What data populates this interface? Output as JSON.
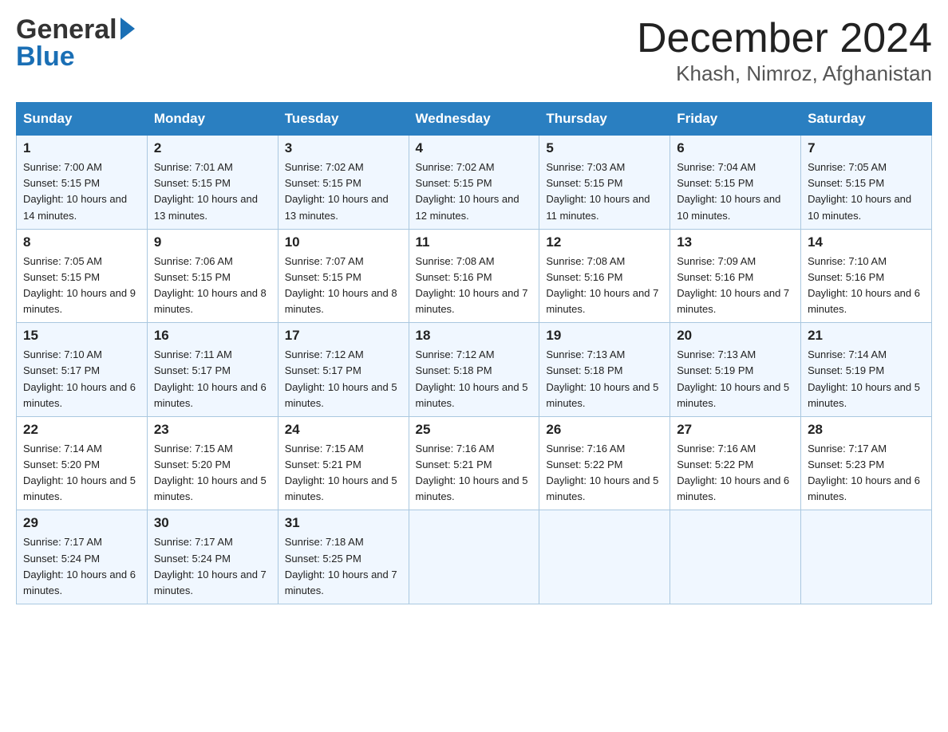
{
  "header": {
    "logo_general": "General",
    "logo_blue": "Blue",
    "month_title": "December 2024",
    "location": "Khash, Nimroz, Afghanistan"
  },
  "days_of_week": [
    "Sunday",
    "Monday",
    "Tuesday",
    "Wednesday",
    "Thursday",
    "Friday",
    "Saturday"
  ],
  "weeks": [
    [
      {
        "day": "1",
        "sunrise": "7:00 AM",
        "sunset": "5:15 PM",
        "daylight": "10 hours and 14 minutes."
      },
      {
        "day": "2",
        "sunrise": "7:01 AM",
        "sunset": "5:15 PM",
        "daylight": "10 hours and 13 minutes."
      },
      {
        "day": "3",
        "sunrise": "7:02 AM",
        "sunset": "5:15 PM",
        "daylight": "10 hours and 13 minutes."
      },
      {
        "day": "4",
        "sunrise": "7:02 AM",
        "sunset": "5:15 PM",
        "daylight": "10 hours and 12 minutes."
      },
      {
        "day": "5",
        "sunrise": "7:03 AM",
        "sunset": "5:15 PM",
        "daylight": "10 hours and 11 minutes."
      },
      {
        "day": "6",
        "sunrise": "7:04 AM",
        "sunset": "5:15 PM",
        "daylight": "10 hours and 10 minutes."
      },
      {
        "day": "7",
        "sunrise": "7:05 AM",
        "sunset": "5:15 PM",
        "daylight": "10 hours and 10 minutes."
      }
    ],
    [
      {
        "day": "8",
        "sunrise": "7:05 AM",
        "sunset": "5:15 PM",
        "daylight": "10 hours and 9 minutes."
      },
      {
        "day": "9",
        "sunrise": "7:06 AM",
        "sunset": "5:15 PM",
        "daylight": "10 hours and 8 minutes."
      },
      {
        "day": "10",
        "sunrise": "7:07 AM",
        "sunset": "5:15 PM",
        "daylight": "10 hours and 8 minutes."
      },
      {
        "day": "11",
        "sunrise": "7:08 AM",
        "sunset": "5:16 PM",
        "daylight": "10 hours and 7 minutes."
      },
      {
        "day": "12",
        "sunrise": "7:08 AM",
        "sunset": "5:16 PM",
        "daylight": "10 hours and 7 minutes."
      },
      {
        "day": "13",
        "sunrise": "7:09 AM",
        "sunset": "5:16 PM",
        "daylight": "10 hours and 7 minutes."
      },
      {
        "day": "14",
        "sunrise": "7:10 AM",
        "sunset": "5:16 PM",
        "daylight": "10 hours and 6 minutes."
      }
    ],
    [
      {
        "day": "15",
        "sunrise": "7:10 AM",
        "sunset": "5:17 PM",
        "daylight": "10 hours and 6 minutes."
      },
      {
        "day": "16",
        "sunrise": "7:11 AM",
        "sunset": "5:17 PM",
        "daylight": "10 hours and 6 minutes."
      },
      {
        "day": "17",
        "sunrise": "7:12 AM",
        "sunset": "5:17 PM",
        "daylight": "10 hours and 5 minutes."
      },
      {
        "day": "18",
        "sunrise": "7:12 AM",
        "sunset": "5:18 PM",
        "daylight": "10 hours and 5 minutes."
      },
      {
        "day": "19",
        "sunrise": "7:13 AM",
        "sunset": "5:18 PM",
        "daylight": "10 hours and 5 minutes."
      },
      {
        "day": "20",
        "sunrise": "7:13 AM",
        "sunset": "5:19 PM",
        "daylight": "10 hours and 5 minutes."
      },
      {
        "day": "21",
        "sunrise": "7:14 AM",
        "sunset": "5:19 PM",
        "daylight": "10 hours and 5 minutes."
      }
    ],
    [
      {
        "day": "22",
        "sunrise": "7:14 AM",
        "sunset": "5:20 PM",
        "daylight": "10 hours and 5 minutes."
      },
      {
        "day": "23",
        "sunrise": "7:15 AM",
        "sunset": "5:20 PM",
        "daylight": "10 hours and 5 minutes."
      },
      {
        "day": "24",
        "sunrise": "7:15 AM",
        "sunset": "5:21 PM",
        "daylight": "10 hours and 5 minutes."
      },
      {
        "day": "25",
        "sunrise": "7:16 AM",
        "sunset": "5:21 PM",
        "daylight": "10 hours and 5 minutes."
      },
      {
        "day": "26",
        "sunrise": "7:16 AM",
        "sunset": "5:22 PM",
        "daylight": "10 hours and 5 minutes."
      },
      {
        "day": "27",
        "sunrise": "7:16 AM",
        "sunset": "5:22 PM",
        "daylight": "10 hours and 6 minutes."
      },
      {
        "day": "28",
        "sunrise": "7:17 AM",
        "sunset": "5:23 PM",
        "daylight": "10 hours and 6 minutes."
      }
    ],
    [
      {
        "day": "29",
        "sunrise": "7:17 AM",
        "sunset": "5:24 PM",
        "daylight": "10 hours and 6 minutes."
      },
      {
        "day": "30",
        "sunrise": "7:17 AM",
        "sunset": "5:24 PM",
        "daylight": "10 hours and 7 minutes."
      },
      {
        "day": "31",
        "sunrise": "7:18 AM",
        "sunset": "5:25 PM",
        "daylight": "10 hours and 7 minutes."
      },
      null,
      null,
      null,
      null
    ]
  ]
}
